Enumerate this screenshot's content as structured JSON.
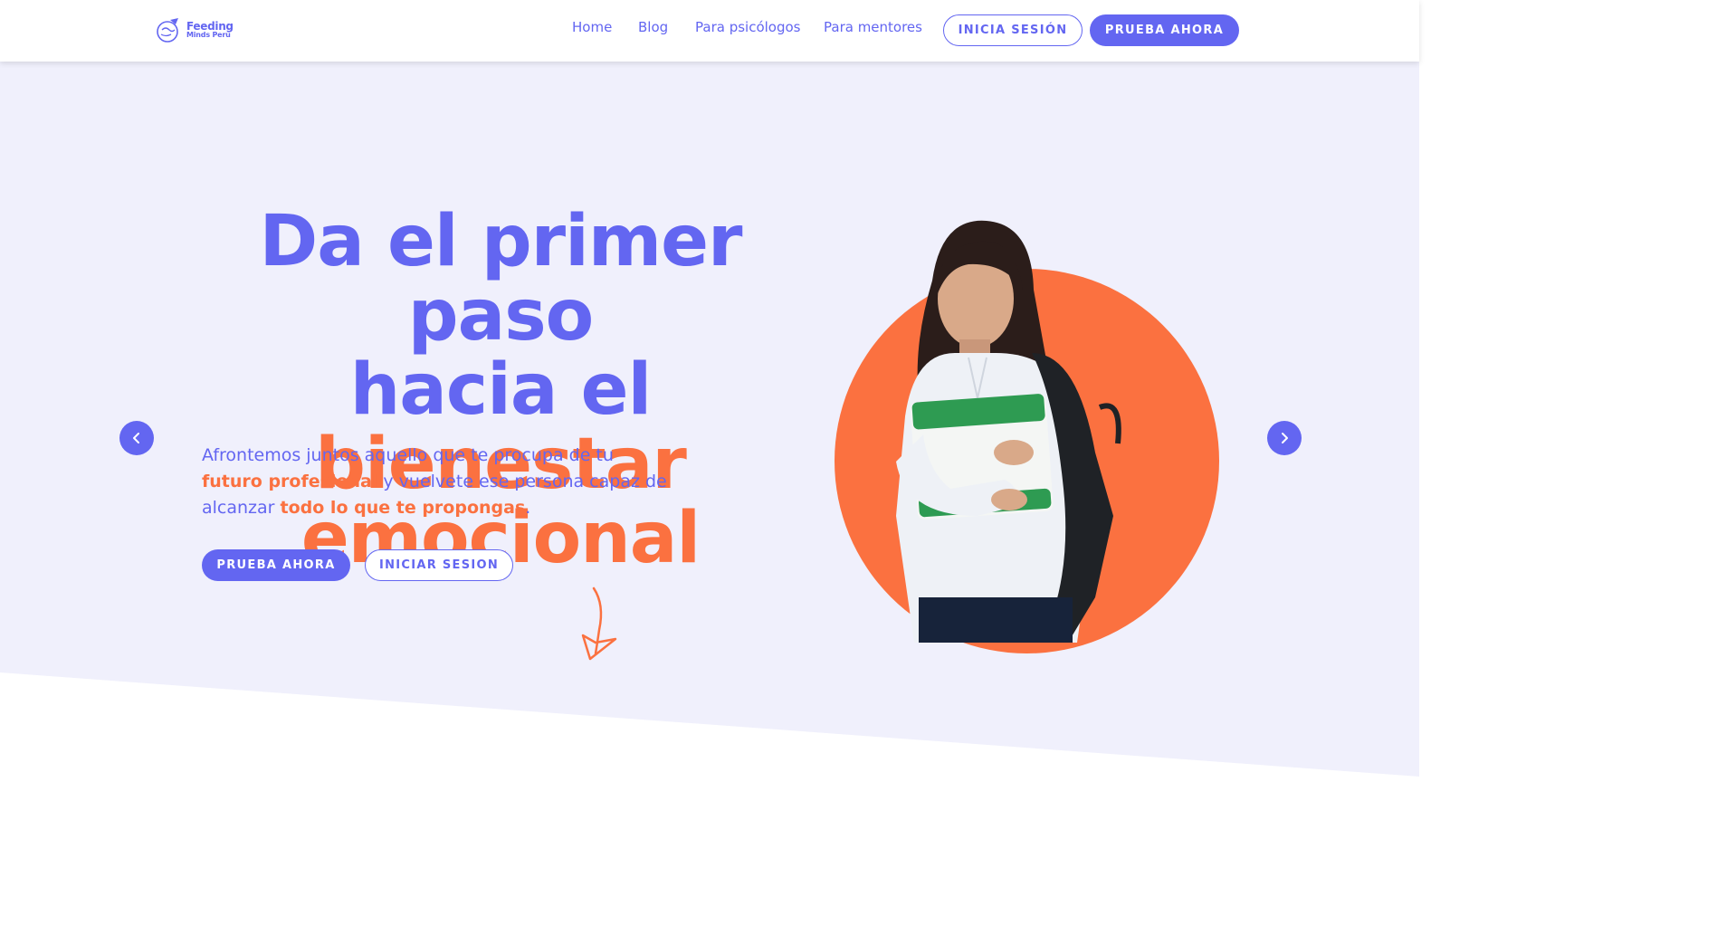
{
  "header": {
    "logo_line1": "Feeding",
    "logo_line2": "Minds Peru",
    "nav": [
      "Home",
      "Blog",
      "Para psicólogos",
      "Para mentores"
    ],
    "login_label": "INICIA SESIÓN",
    "try_label": "PRUEBA AHORA"
  },
  "hero": {
    "headline_part1": "Da el primer paso",
    "headline_part2": "hacia el ",
    "headline_accent1": "bienestar",
    "headline_accent2": "emocional",
    "sub_part1": "Afrontemos juntos aquello que te procupa de tu ",
    "sub_hl1": "futuro profesional",
    "sub_part2": " y vuelvete ese persona capaz de alcanzar ",
    "sub_hl2": "todo lo que te propongas",
    "sub_end": ".",
    "primary_label": "PRUEBA AHORA",
    "secondary_label": "INICIAR SESION",
    "prev_icon": "chevron-left-icon",
    "next_icon": "chevron-right-icon"
  },
  "colors": {
    "primary": "#6366f1",
    "accent": "#fb7140",
    "hero_bg": "#f0f0fc"
  }
}
